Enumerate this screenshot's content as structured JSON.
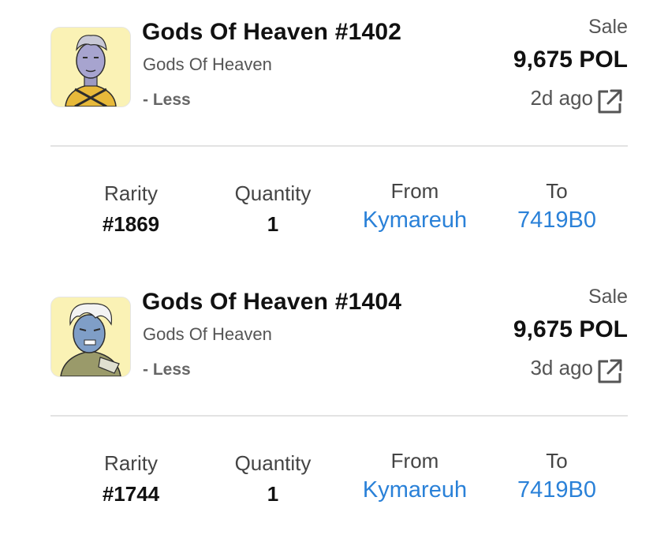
{
  "sales": [
    {
      "title": "Gods Of Heaven #1402",
      "collection": "Gods Of Heaven",
      "toggle_label": "- Less",
      "event": "Sale",
      "price": "9,675 POL",
      "time": "2d ago",
      "thumbnail_icon": "nft-avatar-gold-armor",
      "details": {
        "rarity_label": "Rarity",
        "rarity_value": "#1869",
        "quantity_label": "Quantity",
        "quantity_value": "1",
        "from_label": "From",
        "from_value": "Kymareuh",
        "to_label": "To",
        "to_value": "7419B0"
      }
    },
    {
      "title": "Gods Of Heaven #1404",
      "collection": "Gods Of Heaven",
      "toggle_label": "- Less",
      "event": "Sale",
      "price": "9,675 POL",
      "time": "3d ago",
      "thumbnail_icon": "nft-avatar-blue-orc",
      "details": {
        "rarity_label": "Rarity",
        "rarity_value": "#1744",
        "quantity_label": "Quantity",
        "quantity_value": "1",
        "from_label": "From",
        "from_value": "Kymareuh",
        "to_label": "To",
        "to_value": "7419B0"
      }
    }
  ],
  "colors": {
    "link": "#2a81d8",
    "thumbnail_bg": "#faf2b5",
    "divider": "#e3e3e3"
  }
}
